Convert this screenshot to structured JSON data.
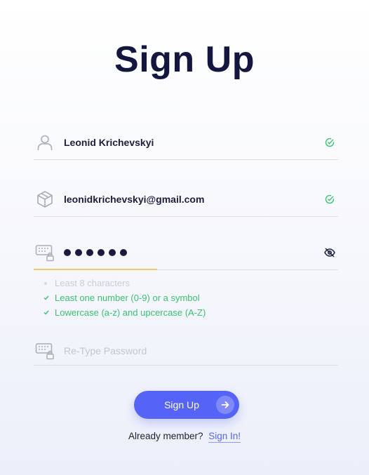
{
  "title": "Sign Up",
  "fields": {
    "name": {
      "value": "Leonid Krichevskyi",
      "icon": "user-icon",
      "status": "valid"
    },
    "email": {
      "value": "leonidkrichevskyi@gmail.com",
      "icon": "box-icon",
      "status": "valid"
    },
    "password": {
      "value": "••••••",
      "icon": "keyboard-lock-icon",
      "strength": 0.4,
      "trailing_icon": "eye-off-icon"
    },
    "retype": {
      "placeholder": "Re-Type Password",
      "icon": "keyboard-lock-icon"
    }
  },
  "rules": [
    {
      "text": "Least 8 characters",
      "met": false
    },
    {
      "text": "Least one number (0-9) or a symbol",
      "met": true
    },
    {
      "text": "Lowercase (a-z) and upcercase (A-Z)",
      "met": true
    }
  ],
  "button": {
    "label": "Sign Up",
    "icon": "arrow-right-icon"
  },
  "footer": {
    "prompt": "Already member?",
    "link": "Sign In!"
  },
  "colors": {
    "accent": "#5563f6",
    "success": "#37c26e",
    "warning": "#f5c76a",
    "title": "#13163f"
  }
}
